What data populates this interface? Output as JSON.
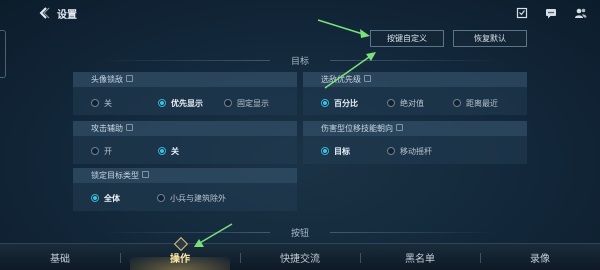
{
  "header": {
    "title": "设置",
    "icons": [
      "back-icon",
      "badge-icon",
      "chat-icon",
      "friends-icon"
    ]
  },
  "actions": {
    "customize_keys": "按键自定义",
    "restore_default": "恢复默认"
  },
  "sections": {
    "target": "目标",
    "buttons": "按钮"
  },
  "panels": {
    "avatar_lock": {
      "label": "头像锁敌",
      "options": [
        "关",
        "优先显示",
        "固定显示"
      ],
      "selected": "优先显示"
    },
    "enemy_priority": {
      "label": "选敌优先级",
      "options": [
        "百分比",
        "绝对值",
        "距离最近"
      ],
      "selected": "百分比"
    },
    "attack_assist": {
      "label": "攻击辅助",
      "options": [
        "开",
        "关"
      ],
      "selected": "关"
    },
    "skill_direction": {
      "label": "伤害型位移技能朝向",
      "options": [
        "目标",
        "移动摇杆"
      ],
      "selected": "目标"
    },
    "lock_target_type": {
      "label": "锁定目标类型",
      "options": [
        "全体",
        "小兵与建筑除外"
      ],
      "selected": "全体"
    }
  },
  "tabs": [
    "基础",
    "操作",
    "快捷交流",
    "黑名单",
    "录像"
  ],
  "active_tab": "操作",
  "colors": {
    "accent": "#38c4ea",
    "active_tab": "#ffe7a8",
    "annotation_arrow": "#7be07b"
  }
}
